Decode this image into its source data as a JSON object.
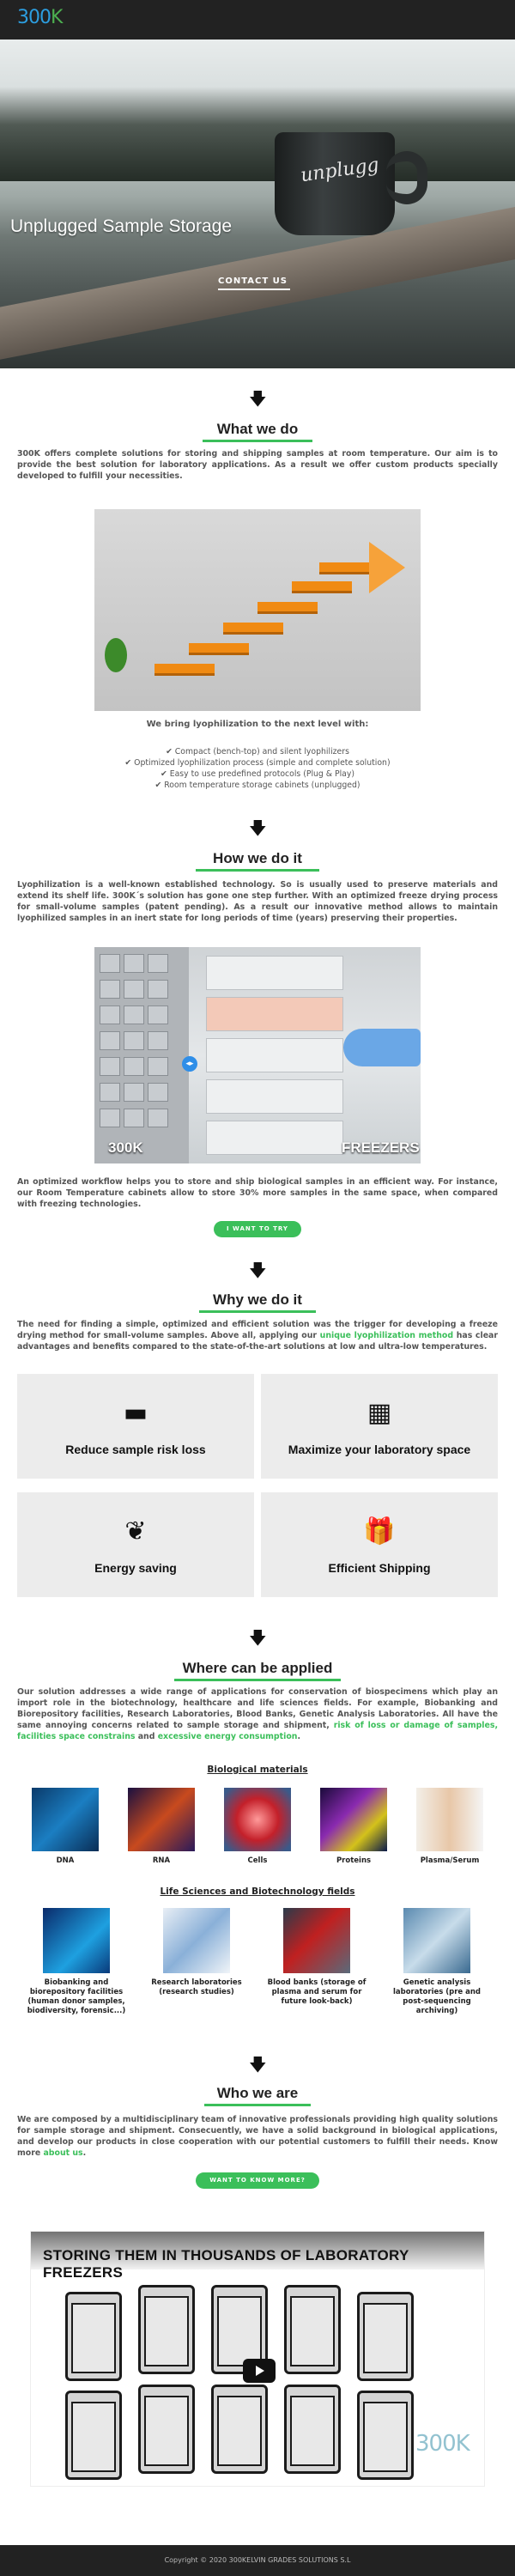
{
  "header": {
    "logo_part1": "3",
    "logo_part2": "00",
    "logo_part3": "K"
  },
  "hero": {
    "title": "Unplugged Sample Storage",
    "mug_text": "unplugg",
    "button_label": "CONTACT US"
  },
  "what_we_do": {
    "heading": "What we do",
    "paragraph": "300K offers complete solutions for storing and shipping samples at room temperature. Our aim is to provide the best solution for laboratory applications. As a result we offer custom products specially developed to fulfill your necessities.",
    "subtitle": "We bring lyophilization to the next level with:",
    "checks": [
      "✔ Compact (bench-top) and silent lyophilizers",
      "✔ Optimized lyophilization process (simple and complete solution)",
      "✔ Easy to use predefined protocols (Plug & Play)",
      "✔ Room temperature storage cabinets (unplugged)"
    ]
  },
  "how_we_do_it": {
    "heading": "How we do it",
    "paragraph": "Lyophilization is a well-known established technology. So is usually used to preserve materials and extend its shelf life. 300K´s solution has gone one step further. With an optimized freeze drying process for small-volume samples (patent pending). As a result our innovative method allows to maintain lyophilized samples in an inert state for long periods of time (years) preserving their properties.",
    "compare_left": "300K",
    "compare_right": "FREEZERS",
    "compare_handle": "◂▸",
    "paragraph2": "An optimized workflow helps you to store and ship biological samples in an efficient way. For instance, our Room Temperature cabinets allow to store 30% more samples in the same space, when compared with freezing technologies.",
    "button_label": "I WANT TO TRY"
  },
  "why_we_do_it": {
    "heading": "Why we do it",
    "paragraph_start": "The need for finding a simple, optimized and efficient solution was the trigger for developing a freeze drying method for small-volume samples.  Above all, applying our ",
    "paragraph_link": "unique lyophilization method",
    "paragraph_end": " has clear advantages and benefits compared to the state-of-the-art solutions at low and ultra-low temperatures.",
    "cards": [
      {
        "icon": "archive-box-icon",
        "glyph": "▬",
        "label": "Reduce sample risk loss"
      },
      {
        "icon": "building-icon",
        "glyph": "▦",
        "label": "Maximize your laboratory space"
      },
      {
        "icon": "leaf-icon",
        "glyph": "❦",
        "label": "Energy saving"
      },
      {
        "icon": "gift-icon",
        "glyph": "🎁",
        "label": "Efficient Shipping"
      }
    ]
  },
  "where": {
    "heading": "Where can be applied",
    "paragraph_start": "Our solution addresses a wide range of applications for conservation of  biospecimens which play an import role in the biotechnology, healthcare and life sciences fields. For example, Biobanking and Biorepository facilities, Research Laboratories, Blood Banks, Genetic Analysis Laboratories. All have the same annoying concerns related to sample storage and shipment, ",
    "paragraph_green1": "risk of loss or damage of samples, facilities space constrains",
    "paragraph_mid": " and ",
    "paragraph_green2": "excessive energy consumption",
    "paragraph_end": ".",
    "bio_heading": "Biological materials",
    "bio_items": [
      "DNA",
      "RNA",
      "Cells",
      "Proteins",
      "Plasma/Serum"
    ],
    "fields_heading": "Life Sciences and Biotechnology fields",
    "field_items": [
      "Biobanking and biorepository facilities (human donor samples, biodiversity, forensic...)",
      "Research laboratories (research studies)",
      "Blood banks (storage of plasma and serum for future look-back)",
      "Genetic analysis laboratories (pre and post-sequencing archiving)"
    ]
  },
  "who": {
    "heading": "Who we are",
    "paragraph_start": "We are composed by a multidisciplinary team of innovative professionals providing high quality solutions for sample storage and shipment. Consecuently, we have a solid background in biological applications, and develop our products in close cooperation with our potential customers to fulfill their needs. Know more ",
    "paragraph_link": "about us",
    "paragraph_end": ".",
    "button_label": "WANT TO KNOW MORE?"
  },
  "video": {
    "title": "STORING THEM IN THOUSANDS OF LABORATORY FREEZERS",
    "watermark": "300K"
  },
  "footer": {
    "copyright": "Copyright © 2020 300KELVIN GRADES SOLUTIONS S.L"
  },
  "colors": {
    "accent_green": "#3bbf5a",
    "logo_blue": "#2c9ee0",
    "header_dark": "#222222"
  }
}
